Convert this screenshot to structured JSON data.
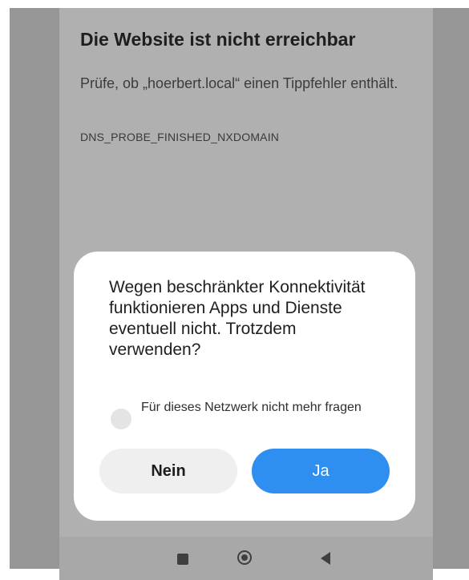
{
  "page": {
    "title": "Die Website ist nicht erreichbar",
    "hint": "Prüfe, ob „hoerbert.local“ einen Tippfehler enthält.",
    "error_code": "DNS_PROBE_FINISHED_NXDOMAIN"
  },
  "dialog": {
    "message": "Wegen beschränkter Konnektivität funktionieren Apps und Dienste eventuell nicht. Trotzdem verwenden?",
    "dont_ask_label": "Für dieses Netzwerk nicht mehr fragen",
    "dont_ask_checked": false,
    "no_label": "Nein",
    "yes_label": "Ja"
  },
  "navbar": {
    "recents_icon": "square-icon",
    "home_icon": "circle-icon",
    "back_icon": "triangle-back-icon"
  },
  "colors": {
    "accent": "#2f8ff0",
    "dim_overlay": "#b0b0b0"
  }
}
